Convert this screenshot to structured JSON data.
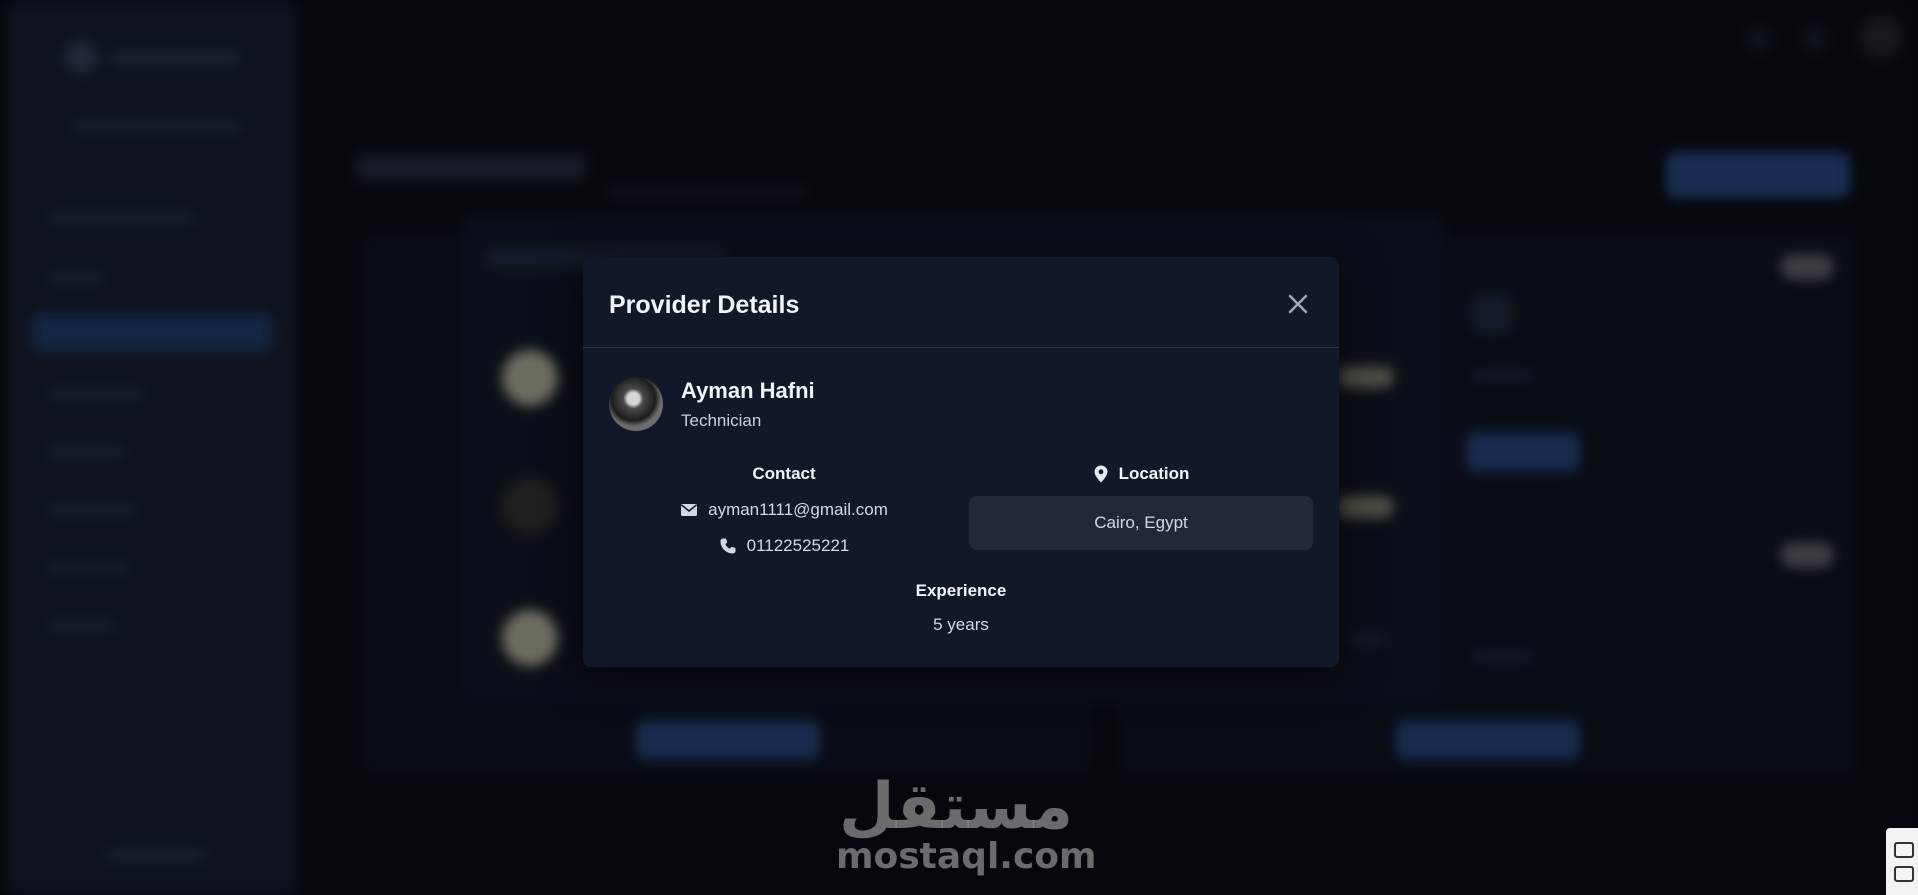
{
  "modal": {
    "title": "Provider Details",
    "provider": {
      "name": "Ayman Hafni",
      "role": "Technician"
    },
    "contact": {
      "heading": "Contact",
      "email": "ayman1111@gmail.com",
      "phone": "01122525221"
    },
    "location": {
      "heading": "Location",
      "value": "Cairo, Egypt"
    },
    "experience": {
      "heading": "Experience",
      "value": "5 years"
    }
  },
  "watermark": {
    "arabic": "مستقل",
    "latin": "mostaql.com"
  },
  "icons": {
    "close": "close-icon",
    "email": "envelope-icon",
    "phone": "phone-icon",
    "location": "map-pin-icon"
  },
  "colors": {
    "modal_bg": "#111827",
    "location_box_bg": "#1f2937",
    "sidebar_bg": "#1a2436",
    "accent": "#2f5496"
  }
}
